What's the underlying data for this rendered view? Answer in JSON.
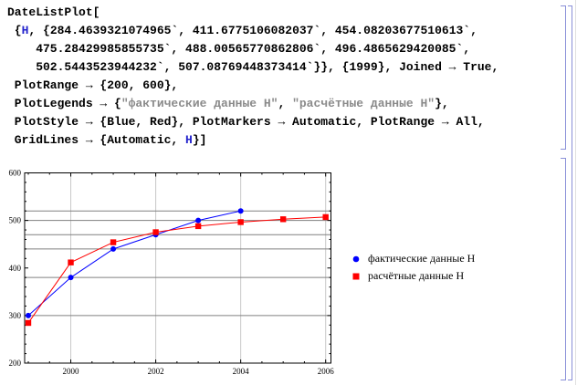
{
  "input_cell": {
    "lines": [
      [
        {
          "t": "DateListPlot[",
          "c": ""
        }
      ],
      [
        {
          "t": " {",
          "c": ""
        },
        {
          "t": "H",
          "c": "sym"
        },
        {
          "t": ", {284.4639321074965`, 411.6775106082037`, 454.08203677510613`,",
          "c": ""
        }
      ],
      [
        {
          "t": "    475.28429985855735`, 488.00565770862806`, 496.4865629420085`,",
          "c": ""
        }
      ],
      [
        {
          "t": "    502.5443523944232`, 507.08769448373414`}}, {1999}, Joined → True,",
          "c": ""
        }
      ],
      [
        {
          "t": " PlotRange → {200, 600},",
          "c": ""
        }
      ],
      [
        {
          "t": " PlotLegends → {",
          "c": ""
        },
        {
          "t": "\"фактические данные H\"",
          "c": "str"
        },
        {
          "t": ", ",
          "c": ""
        },
        {
          "t": "\"расчётные данные H\"",
          "c": "str"
        },
        {
          "t": "},",
          "c": ""
        }
      ],
      [
        {
          "t": " PlotStyle → {Blue, Red}, PlotMarkers → Automatic, PlotRange → All,",
          "c": ""
        }
      ],
      [
        {
          "t": " GridLines → {Automatic, ",
          "c": ""
        },
        {
          "t": "H",
          "c": "sym"
        },
        {
          "t": "}]",
          "c": ""
        }
      ]
    ]
  },
  "colors": {
    "series1": "#0000ff",
    "series2": "#ff0000",
    "cell_bracket": "#8a90d8",
    "grid_h": "#808080",
    "grid_v": "#c8c8c8"
  },
  "chart_data": {
    "type": "line",
    "title": "",
    "xlabel": "",
    "ylabel": "",
    "xlim": [
      1999,
      2006
    ],
    "ylim": [
      200,
      600
    ],
    "x_ticks": [
      "2000",
      "2002",
      "2004",
      "2006"
    ],
    "y_ticks": [
      "200",
      "300",
      "400",
      "500",
      "600"
    ],
    "grid": {
      "x": [
        2000,
        2002,
        2004,
        2006
      ],
      "y": [
        300,
        380,
        440,
        470,
        500,
        520
      ]
    },
    "legend_position": "right",
    "series": [
      {
        "name": "фактические данные H",
        "marker": "circle",
        "x": [
          1999,
          2000,
          2001,
          2002,
          2003,
          2004
        ],
        "values": [
          300,
          380,
          440,
          470,
          500,
          520
        ]
      },
      {
        "name": "расчётные данные H",
        "marker": "square",
        "x": [
          1999,
          2000,
          2001,
          2002,
          2003,
          2004,
          2005,
          2006
        ],
        "values": [
          284.4639321074965,
          411.6775106082037,
          454.08203677510613,
          475.28429985855735,
          488.00565770862806,
          496.4865629420085,
          502.5443523944232,
          507.08769448373414
        ]
      }
    ]
  }
}
